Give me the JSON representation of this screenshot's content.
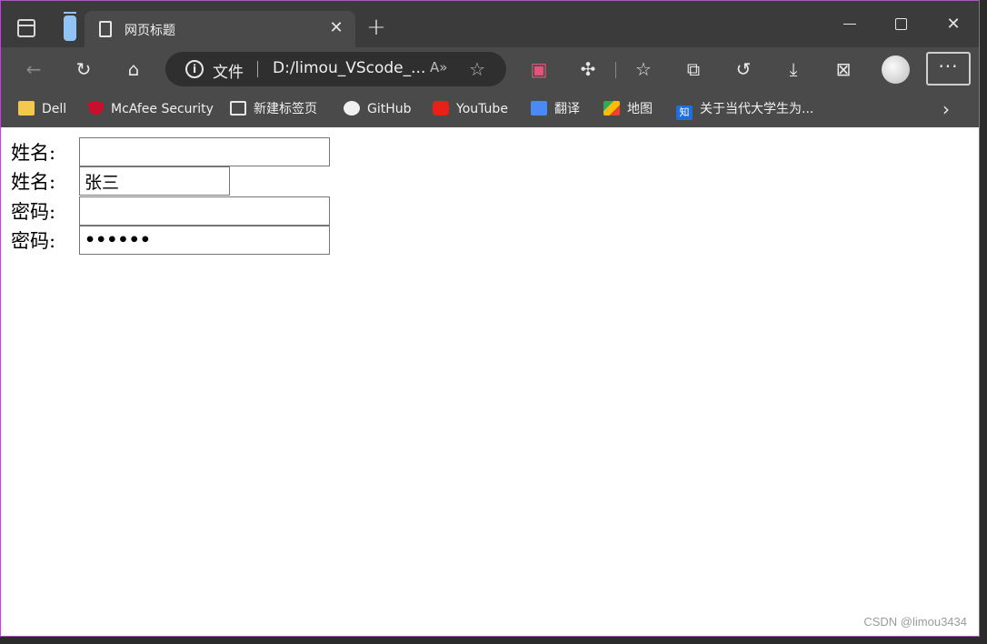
{
  "tab": {
    "title": "网页标题"
  },
  "address": {
    "scheme_label": "文件",
    "url": "D:/limou_VScode_...",
    "read_aloud": "A⁰"
  },
  "bookmarks": [
    {
      "label": "Dell",
      "icon": "folder-icon"
    },
    {
      "label": "McAfee Security",
      "icon": "mcafee-icon"
    },
    {
      "label": "新建标签页",
      "icon": "new-tab-icon"
    },
    {
      "label": "GitHub",
      "icon": "github-icon"
    },
    {
      "label": "YouTube",
      "icon": "youtube-icon"
    },
    {
      "label": "翻译",
      "icon": "translate-icon"
    },
    {
      "label": "地图",
      "icon": "maps-icon"
    },
    {
      "label": "关于当代大学生为...",
      "icon": "zhihu-icon"
    }
  ],
  "form": {
    "rows": [
      {
        "label": "姓名:",
        "value": "",
        "type": "text"
      },
      {
        "label": "姓名:",
        "value": "张三",
        "type": "text"
      },
      {
        "label": "密码:",
        "value": "",
        "type": "password"
      },
      {
        "label": "密码:",
        "value": "••••••",
        "type": "password"
      }
    ]
  },
  "zhihu_char": "知",
  "watermark": "CSDN @limou3434"
}
